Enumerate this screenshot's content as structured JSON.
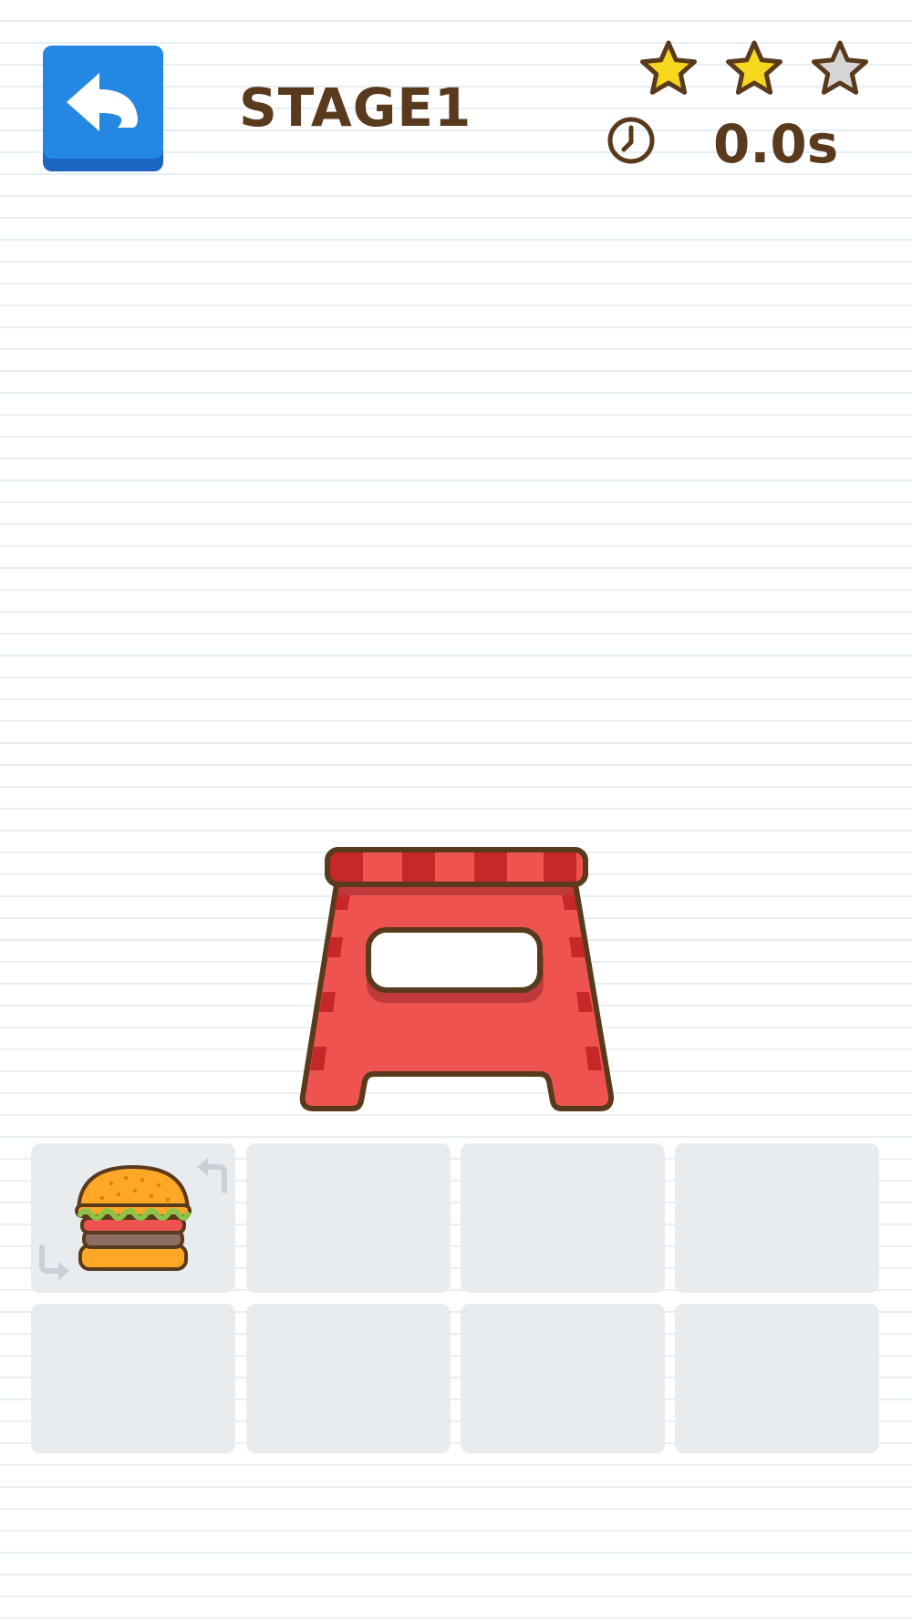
{
  "header": {
    "back_label": "back",
    "stage_title": "STAGE1",
    "timer_text": "0.0s"
  },
  "stars": {
    "earned": 2,
    "total": 3,
    "filled_color": "#f6d71e",
    "empty_color": "#d5d5d5"
  },
  "scene": {
    "object": "step-stool",
    "object_color": "#ef5350"
  },
  "inventory": {
    "rows": 2,
    "columns": 4,
    "slots": [
      {
        "item": "hamburger",
        "rotatable": true
      },
      {
        "item": null
      },
      {
        "item": null
      },
      {
        "item": null
      },
      {
        "item": null
      },
      {
        "item": null
      },
      {
        "item": null
      },
      {
        "item": null
      }
    ]
  },
  "colors": {
    "accent": "#2488e3",
    "text": "#5a3a1c",
    "slot_background": "#e9ecef"
  }
}
